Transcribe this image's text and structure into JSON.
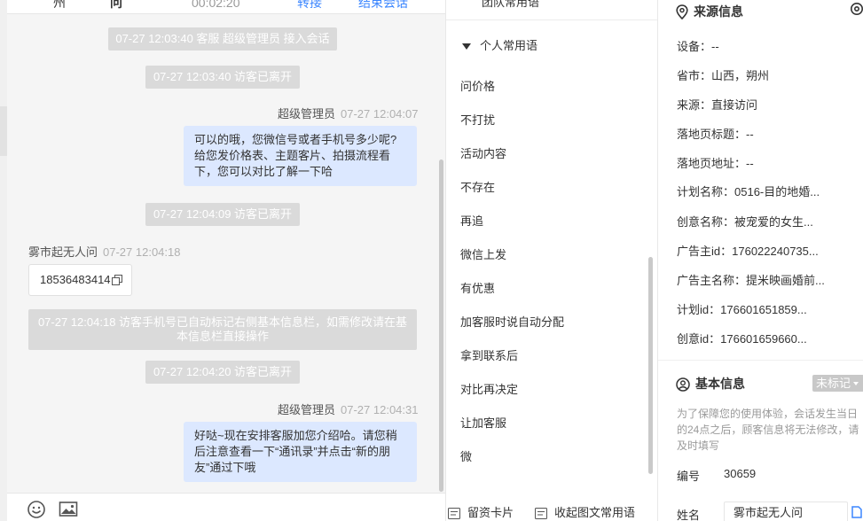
{
  "chat_header": {
    "city": "州",
    "ask": "问",
    "duration": "00:02:20",
    "transfer_label": "转接",
    "end_label": "结束会话"
  },
  "chat": {
    "sys1": "07-27 12:03:40 客服 超级管理员 接入会话",
    "sys2": "07-27 12:03:40 访客已离开",
    "agent_msg1": {
      "sender": "超级管理员",
      "time": "07-27 12:04:07",
      "text": "可以的哦，您微信号或者手机号多少呢?给您发价格表、主题客片、拍摄流程看下，您可以对比了解一下哈"
    },
    "sys3": "07-27 12:04:09 访客已离开",
    "visitor_msg": {
      "sender": "雾市起无人问",
      "time": "07-27 12:04:18",
      "text": "18536483414"
    },
    "sys4": "07-27 12:04:18 访客手机号已自动标记右侧基本信息栏，如需修改请在基本信息栏直接操作",
    "sys5": "07-27 12:04:20 访客已离开",
    "agent_msg2": {
      "sender": "超级管理员",
      "time": "07-27 12:04:31",
      "text": "好哒~现在安排客服加您介绍哈。请您稍后注意查看一下“通讯录”并点击“新的朋友”通过下哦"
    }
  },
  "phrases": {
    "top_item": "团队常用语",
    "group_label": "个人常用语",
    "items": [
      "问价格",
      "不打扰",
      "活动内容",
      "不存在",
      "再追",
      "微信上发",
      "有优惠",
      "加客服时说自动分配",
      "拿到联系后",
      "对比再决定",
      "让加客服",
      "微"
    ],
    "footer_card": "留资卡片",
    "footer_collapse": "收起图文常用语"
  },
  "info": {
    "source_title": "来源信息",
    "source_rows": [
      {
        "label": "设备：",
        "value": "--"
      },
      {
        "label": "省市：",
        "value": "山西，朔州"
      },
      {
        "label": "来源：",
        "value": "直接访问"
      },
      {
        "label": "落地页标题：",
        "value": "--"
      },
      {
        "label": "落地页地址：",
        "value": "--"
      },
      {
        "label": "计划名称：",
        "value": "0516-目的地婚..."
      },
      {
        "label": "创意名称：",
        "value": "被宠爱的女生..."
      },
      {
        "label": "广告主id：",
        "value": "176022240735..."
      },
      {
        "label": "广告主名称：",
        "value": "提米映画婚前..."
      },
      {
        "label": "计划id：",
        "value": "176601651859..."
      },
      {
        "label": "创意id：",
        "value": "176601659660..."
      }
    ],
    "basic_title": "基本信息",
    "tag_label": "未标记",
    "note": "为了保障您的使用体验，会话发生当日的24点之后，顾客信息将无法修改，请及时填写",
    "number_label": "编号",
    "number_value": "30659",
    "name_label": "姓名",
    "name_value": "雾市起无人问"
  },
  "colors": {
    "accent": "#3b86ff",
    "bubble": "#dce8ff",
    "system_badge": "#dadada"
  }
}
